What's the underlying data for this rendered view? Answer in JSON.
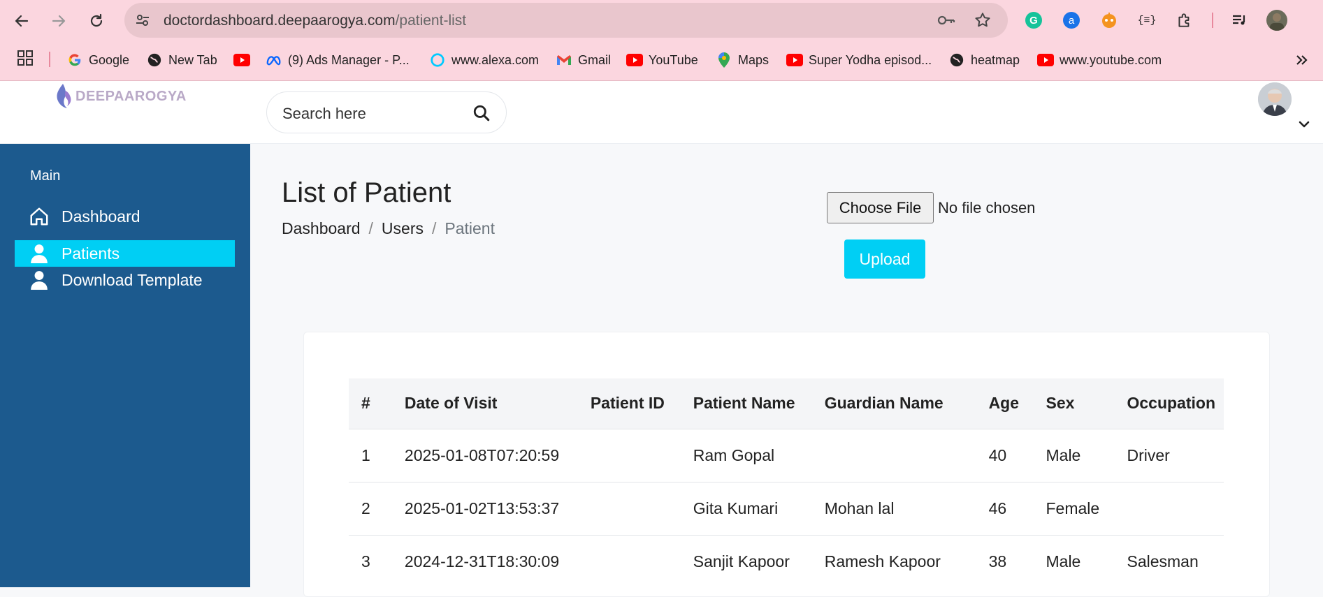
{
  "browser": {
    "url_domain": "doctordashboard.deepaarogya.com",
    "url_path": "/patient-list",
    "bookmarks": [
      {
        "label": "Google",
        "icon": "google-icon"
      },
      {
        "label": "New Tab",
        "icon": "globe-icon"
      },
      {
        "label": "",
        "icon": "youtube-icon"
      },
      {
        "label": "(9) Ads Manager - P...",
        "icon": "meta-icon"
      },
      {
        "label": "www.alexa.com",
        "icon": "alexa-icon"
      },
      {
        "label": "Gmail",
        "icon": "gmail-icon"
      },
      {
        "label": "YouTube",
        "icon": "youtube-icon"
      },
      {
        "label": "Maps",
        "icon": "maps-icon"
      },
      {
        "label": "Super Yodha episod...",
        "icon": "youtube-icon"
      },
      {
        "label": "heatmap",
        "icon": "globe-icon"
      },
      {
        "label": "www.youtube.com",
        "icon": "youtube-icon"
      }
    ]
  },
  "header": {
    "logo_text": "DEEPAAROGYA",
    "search_placeholder": "Search here"
  },
  "sidebar": {
    "section_label": "Main",
    "items": [
      {
        "label": "Dashboard",
        "icon": "home-icon"
      },
      {
        "label": "Patients",
        "icon": "user-icon"
      },
      {
        "label": "Download Template",
        "icon": "user-icon"
      }
    ]
  },
  "main": {
    "title": "List of Patient",
    "breadcrumb": [
      "Dashboard",
      "Users",
      "Patient"
    ],
    "file_button": "Choose File",
    "file_status": "No file chosen",
    "upload_button": "Upload"
  },
  "table": {
    "columns": [
      "#",
      "Date of Visit",
      "Patient ID",
      "Patient Name",
      "Guardian Name",
      "Age",
      "Sex",
      "Occupation"
    ],
    "rows": [
      [
        "1",
        "2025-01-08T07:20:59",
        "",
        "Ram Gopal",
        "",
        "40",
        "Male",
        "Driver"
      ],
      [
        "2",
        "2025-01-02T13:53:37",
        "",
        "Gita Kumari",
        "Mohan lal",
        "46",
        "Female",
        ""
      ],
      [
        "3",
        "2024-12-31T18:30:09",
        "",
        "Sanjit Kapoor",
        "Ramesh Kapoor",
        "38",
        "Male",
        "Salesman"
      ]
    ]
  },
  "colors": {
    "sidebar": "#1c5a8e",
    "accent": "#00cff4",
    "chrome": "#fbd6df"
  }
}
